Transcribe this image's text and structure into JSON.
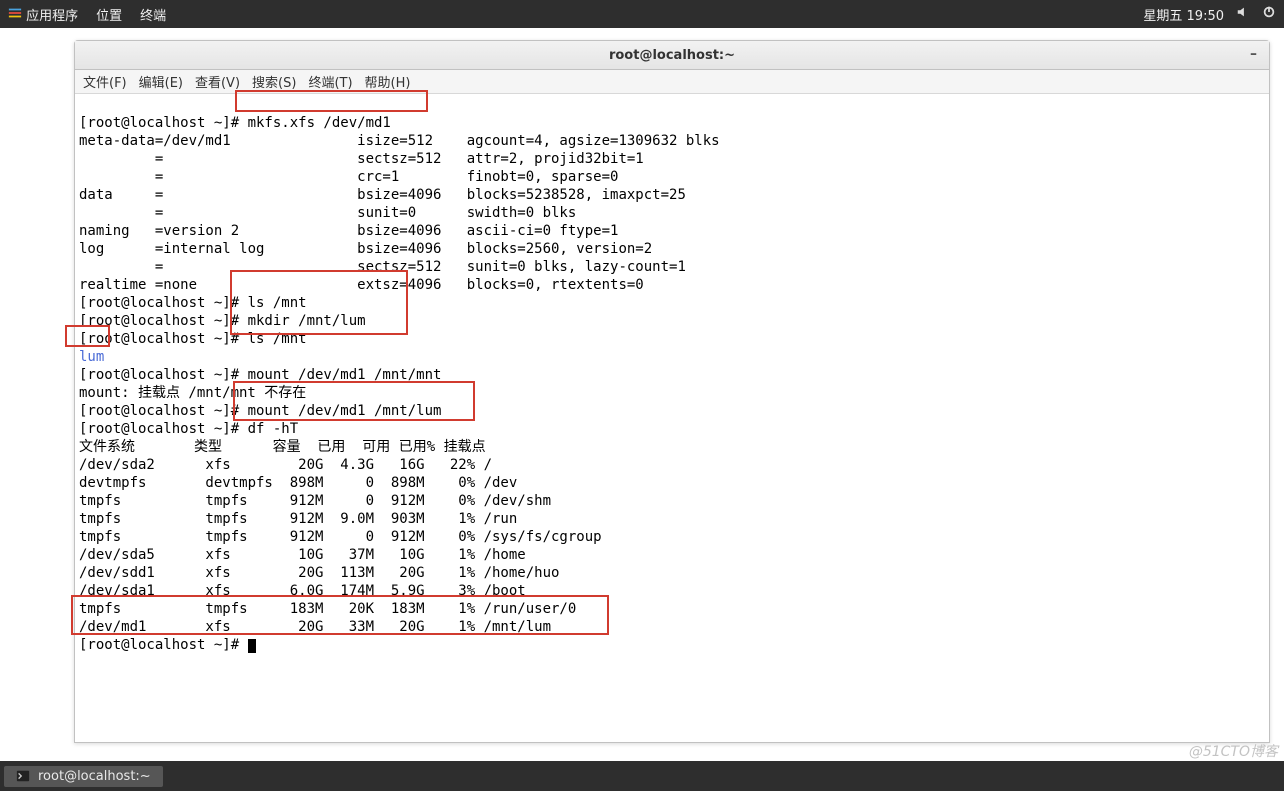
{
  "panel": {
    "apps": "应用程序",
    "places": "位置",
    "terminal": "终端",
    "clock": "星期五 19:50"
  },
  "window": {
    "title": "root@localhost:~"
  },
  "menu": {
    "file": "文件(F)",
    "edit": "编辑(E)",
    "view": "查看(V)",
    "search": "搜索(S)",
    "terminal": "终端(T)",
    "help": "帮助(H)"
  },
  "term": {
    "l1": "[root@localhost ~]# mkfs.xfs /dev/md1",
    "l2": "meta-data=/dev/md1               isize=512    agcount=4, agsize=1309632 blks",
    "l3": "         =                       sectsz=512   attr=2, projid32bit=1",
    "l4": "         =                       crc=1        finobt=0, sparse=0",
    "l5": "data     =                       bsize=4096   blocks=5238528, imaxpct=25",
    "l6": "         =                       sunit=0      swidth=0 blks",
    "l7": "naming   =version 2              bsize=4096   ascii-ci=0 ftype=1",
    "l8": "log      =internal log           bsize=4096   blocks=2560, version=2",
    "l9": "         =                       sectsz=512   sunit=0 blks, lazy-count=1",
    "l10": "realtime =none                   extsz=4096   blocks=0, rtextents=0",
    "l11": "[root@localhost ~]# ls /mnt",
    "l12": "[root@localhost ~]# mkdir /mnt/lum",
    "l13": "[root@localhost ~]# ls /mnt",
    "l14": "lum",
    "l15": "[root@localhost ~]# mount /dev/md1 /mnt/mnt",
    "l16": "mount: 挂载点 /mnt/mnt 不存在",
    "l17": "[root@localhost ~]# mount /dev/md1 /mnt/lum",
    "l18": "[root@localhost ~]# df -hT",
    "l19": "文件系统       类型      容量  已用  可用 已用% 挂载点",
    "l20": "/dev/sda2      xfs        20G  4.3G   16G   22% /",
    "l21": "devtmpfs       devtmpfs  898M     0  898M    0% /dev",
    "l22": "tmpfs          tmpfs     912M     0  912M    0% /dev/shm",
    "l23": "tmpfs          tmpfs     912M  9.0M  903M    1% /run",
    "l24": "tmpfs          tmpfs     912M     0  912M    0% /sys/fs/cgroup",
    "l25": "/dev/sda5      xfs        10G   37M   10G    1% /home",
    "l26": "/dev/sdd1      xfs        20G  113M   20G    1% /home/huo",
    "l27": "/dev/sda1      xfs       6.0G  174M  5.9G    3% /boot",
    "l28": "tmpfs          tmpfs     183M   20K  183M    1% /run/user/0",
    "l29": "/dev/md1       xfs        20G   33M   20G    1% /mnt/lum",
    "l30": "[root@localhost ~]# "
  },
  "taskbar": {
    "item": "root@localhost:~"
  },
  "watermark": "@51CTO博客"
}
